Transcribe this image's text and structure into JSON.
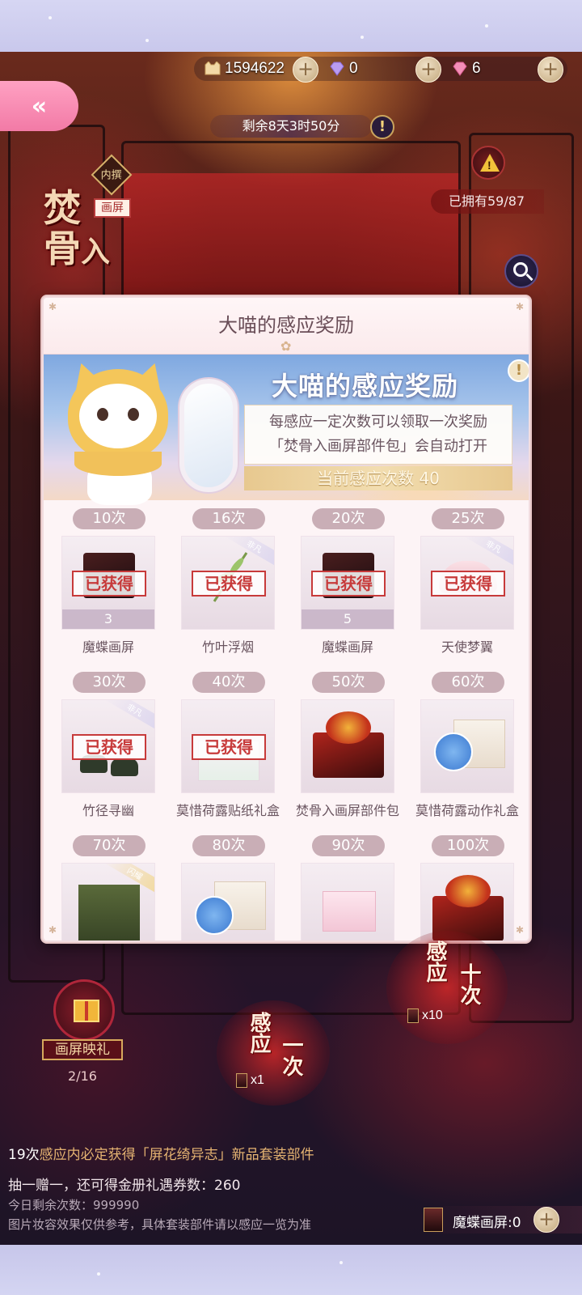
{
  "currency": [
    {
      "name": "cat-coin",
      "value": "1594622"
    },
    {
      "name": "diamond",
      "value": "0"
    },
    {
      "name": "pink-diamond",
      "value": "6"
    }
  ],
  "timer": "剩余8天3时50分",
  "owned": "已拥有59/87",
  "set_title": [
    "焚",
    "骨",
    "入"
  ],
  "badges": {
    "inner": "内撰",
    "screen": "画屏"
  },
  "modal": {
    "title": "大喵的感应奖励",
    "banner_title": "大喵的感应奖励",
    "desc_line1": "每感应一定次数可以领取一次奖励",
    "desc_line2": "「焚骨入画屏部件包」会自动打开",
    "current_count": "当前感应次数 40"
  },
  "rewards": [
    {
      "count": "10次",
      "name": "魔蝶画屏",
      "qty": "3",
      "stamp": "已获得"
    },
    {
      "count": "16次",
      "name": "竹叶浮烟",
      "qty": "",
      "stamp": "已获得",
      "rare": "非凡"
    },
    {
      "count": "20次",
      "name": "魔蝶画屏",
      "qty": "5",
      "stamp": "已获得"
    },
    {
      "count": "25次",
      "name": "天使梦翼",
      "qty": "",
      "stamp": "已获得",
      "rare": "非凡"
    },
    {
      "count": "30次",
      "name": "竹径寻幽",
      "qty": "",
      "stamp": "已获得",
      "rare": "非凡"
    },
    {
      "count": "40次",
      "name": "莫惜荷露贴纸礼盒",
      "qty": "",
      "stamp": "已获得"
    },
    {
      "count": "50次",
      "name": "焚骨入画屏部件包",
      "qty": "",
      "stamp": ""
    },
    {
      "count": "60次",
      "name": "莫惜荷露动作礼盒",
      "qty": "",
      "stamp": ""
    },
    {
      "count": "70次",
      "name": "",
      "qty": "",
      "stamp": "",
      "rare": "闪耀"
    },
    {
      "count": "80次",
      "name": "",
      "qty": "",
      "stamp": ""
    },
    {
      "count": "90次",
      "name": "",
      "qty": "",
      "stamp": ""
    },
    {
      "count": "100次",
      "name": "",
      "qty": "",
      "stamp": ""
    }
  ],
  "gift": {
    "label": "画屏映礼",
    "count": "2/16"
  },
  "summon_one": {
    "label": "感应一次",
    "cost": "x1"
  },
  "summon_ten": {
    "label": "感应十次",
    "cost": "x10"
  },
  "notes": {
    "guarantee_num": "19次",
    "guarantee_text": "感应内必定获得「屏花绮异志」新品套装部件",
    "bonus": "抽一赠一，还可得金册礼遇券数：260",
    "remaining": "今日剩余次数：999990",
    "disclaimer": "图片妆容效果仅供参考，具体套装部件请以感应一览为准"
  },
  "bottom_resource": "魔蝶画屏:0",
  "icons": {
    "back": "double-chevron-left-icon",
    "plus": "plus-icon",
    "info": "exclamation-icon",
    "search": "magnifier-icon",
    "gift": "gift-box-icon"
  }
}
